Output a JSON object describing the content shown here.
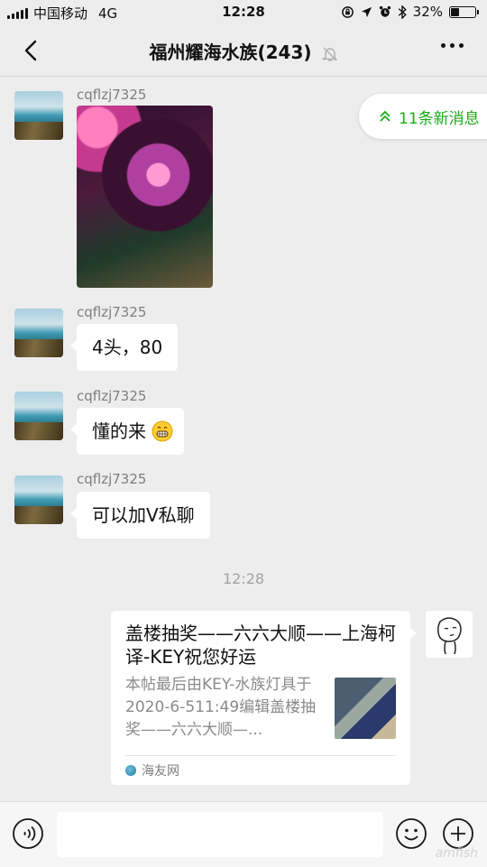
{
  "status_bar": {
    "carrier": "中国移动",
    "network": "4G",
    "time": "12:28",
    "battery": "32%",
    "battery_level": 0.32
  },
  "header": {
    "title": "福州耀海水族(243)"
  },
  "new_messages_pill": "11条新消息",
  "messages": [
    {
      "sender": "cqflzj7325",
      "type": "image"
    },
    {
      "sender": "cqflzj7325",
      "text": "4头，80"
    },
    {
      "sender": "cqflzj7325",
      "text": "懂的来"
    },
    {
      "sender": "cqflzj7325",
      "text": "可以加V私聊"
    }
  ],
  "timestamp": "12:28",
  "link_card": {
    "title": "盖楼抽奖——六六大顺——上海柯译-KEY祝您好运",
    "description": "本帖最后由KEY-水族灯具于2020-6-511:49编辑盖楼抽奖——六六大顺—...",
    "source": "海友网"
  },
  "watermark": "amfish",
  "colors": {
    "accent_green": "#19ad19",
    "background": "#ededed",
    "bubble": "#ffffff"
  }
}
